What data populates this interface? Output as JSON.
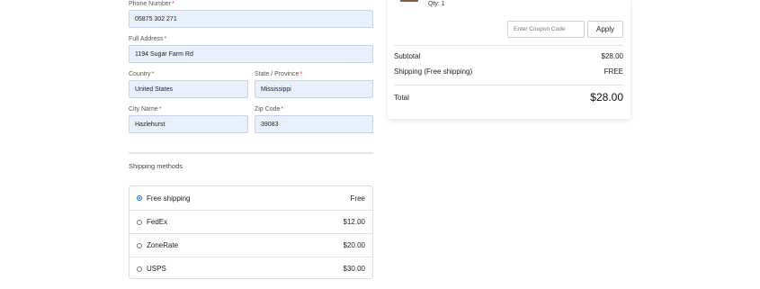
{
  "form": {
    "phone": {
      "label": "Phone Number",
      "required": "*",
      "value": "05875 302 271"
    },
    "address": {
      "label": "Full Address",
      "required": "*",
      "value": "1194 Sugar Farm Rd"
    },
    "country": {
      "label": "Country",
      "required": "*",
      "value": "United States"
    },
    "state": {
      "label": "State / Province",
      "required": "*",
      "value": "Mississippi"
    },
    "city": {
      "label": "City Name",
      "required": "*",
      "value": "Hazlehurst"
    },
    "zip": {
      "label": "Zip Code",
      "required": "*",
      "value": "39083"
    }
  },
  "shipping": {
    "title": "Shipping methods",
    "methods": [
      {
        "name": "Free shipping",
        "price": "Free",
        "selected": true
      },
      {
        "name": "FedEx",
        "price": "$12.00",
        "selected": false
      },
      {
        "name": "ZoneRate",
        "price": "$20.00",
        "selected": false
      },
      {
        "name": "USPS",
        "price": "$30.00",
        "selected": false
      }
    ]
  },
  "summary": {
    "qty": "Qty: 1",
    "coupon_placeholder": "Enter Coupon Code",
    "apply_label": "Apply",
    "subtotal_label": "Subtotal",
    "subtotal_value": "$28.00",
    "shipping_label": "Shipping (Free shipping)",
    "shipping_value": "FREE",
    "total_label": "Total",
    "total_value": "$28.00"
  },
  "colors": {
    "input_bg": "#e8f0fe",
    "required": "#e53935",
    "radio_selected": "#1a73e8",
    "product_thumb": "#8b5a3c"
  }
}
